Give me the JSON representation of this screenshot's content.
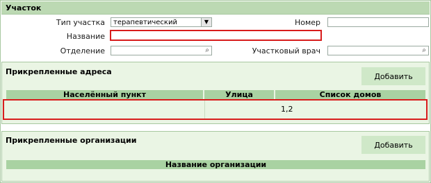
{
  "panel": {
    "title": "Участок"
  },
  "form": {
    "type_label": "Тип участка",
    "type_value": "терапевтический",
    "number_label": "Номер",
    "number_value": "",
    "name_label": "Название",
    "name_value": "",
    "department_label": "Отделение",
    "department_value": "",
    "doctor_label": "Участковый врач",
    "doctor_value": ""
  },
  "addresses": {
    "title": "Прикрепленные адреса",
    "add_label": "Добавить",
    "columns": [
      "Населённый пункт",
      "Улица",
      "Список домов"
    ],
    "rows": [
      {
        "settlement": "",
        "street": "",
        "houses": "1,2"
      }
    ]
  },
  "organizations": {
    "title": "Прикрепленные организации",
    "add_label": "Добавить",
    "columns": [
      "Название организации"
    ]
  },
  "icons": {
    "dropdown": "chevron-down-icon",
    "search": "magnifier-icon"
  },
  "colors": {
    "header_green": "#bcd9b3",
    "section_bg": "#eaf5e4",
    "table_header": "#a9d2a2",
    "highlight_red": "#d81c1c"
  }
}
